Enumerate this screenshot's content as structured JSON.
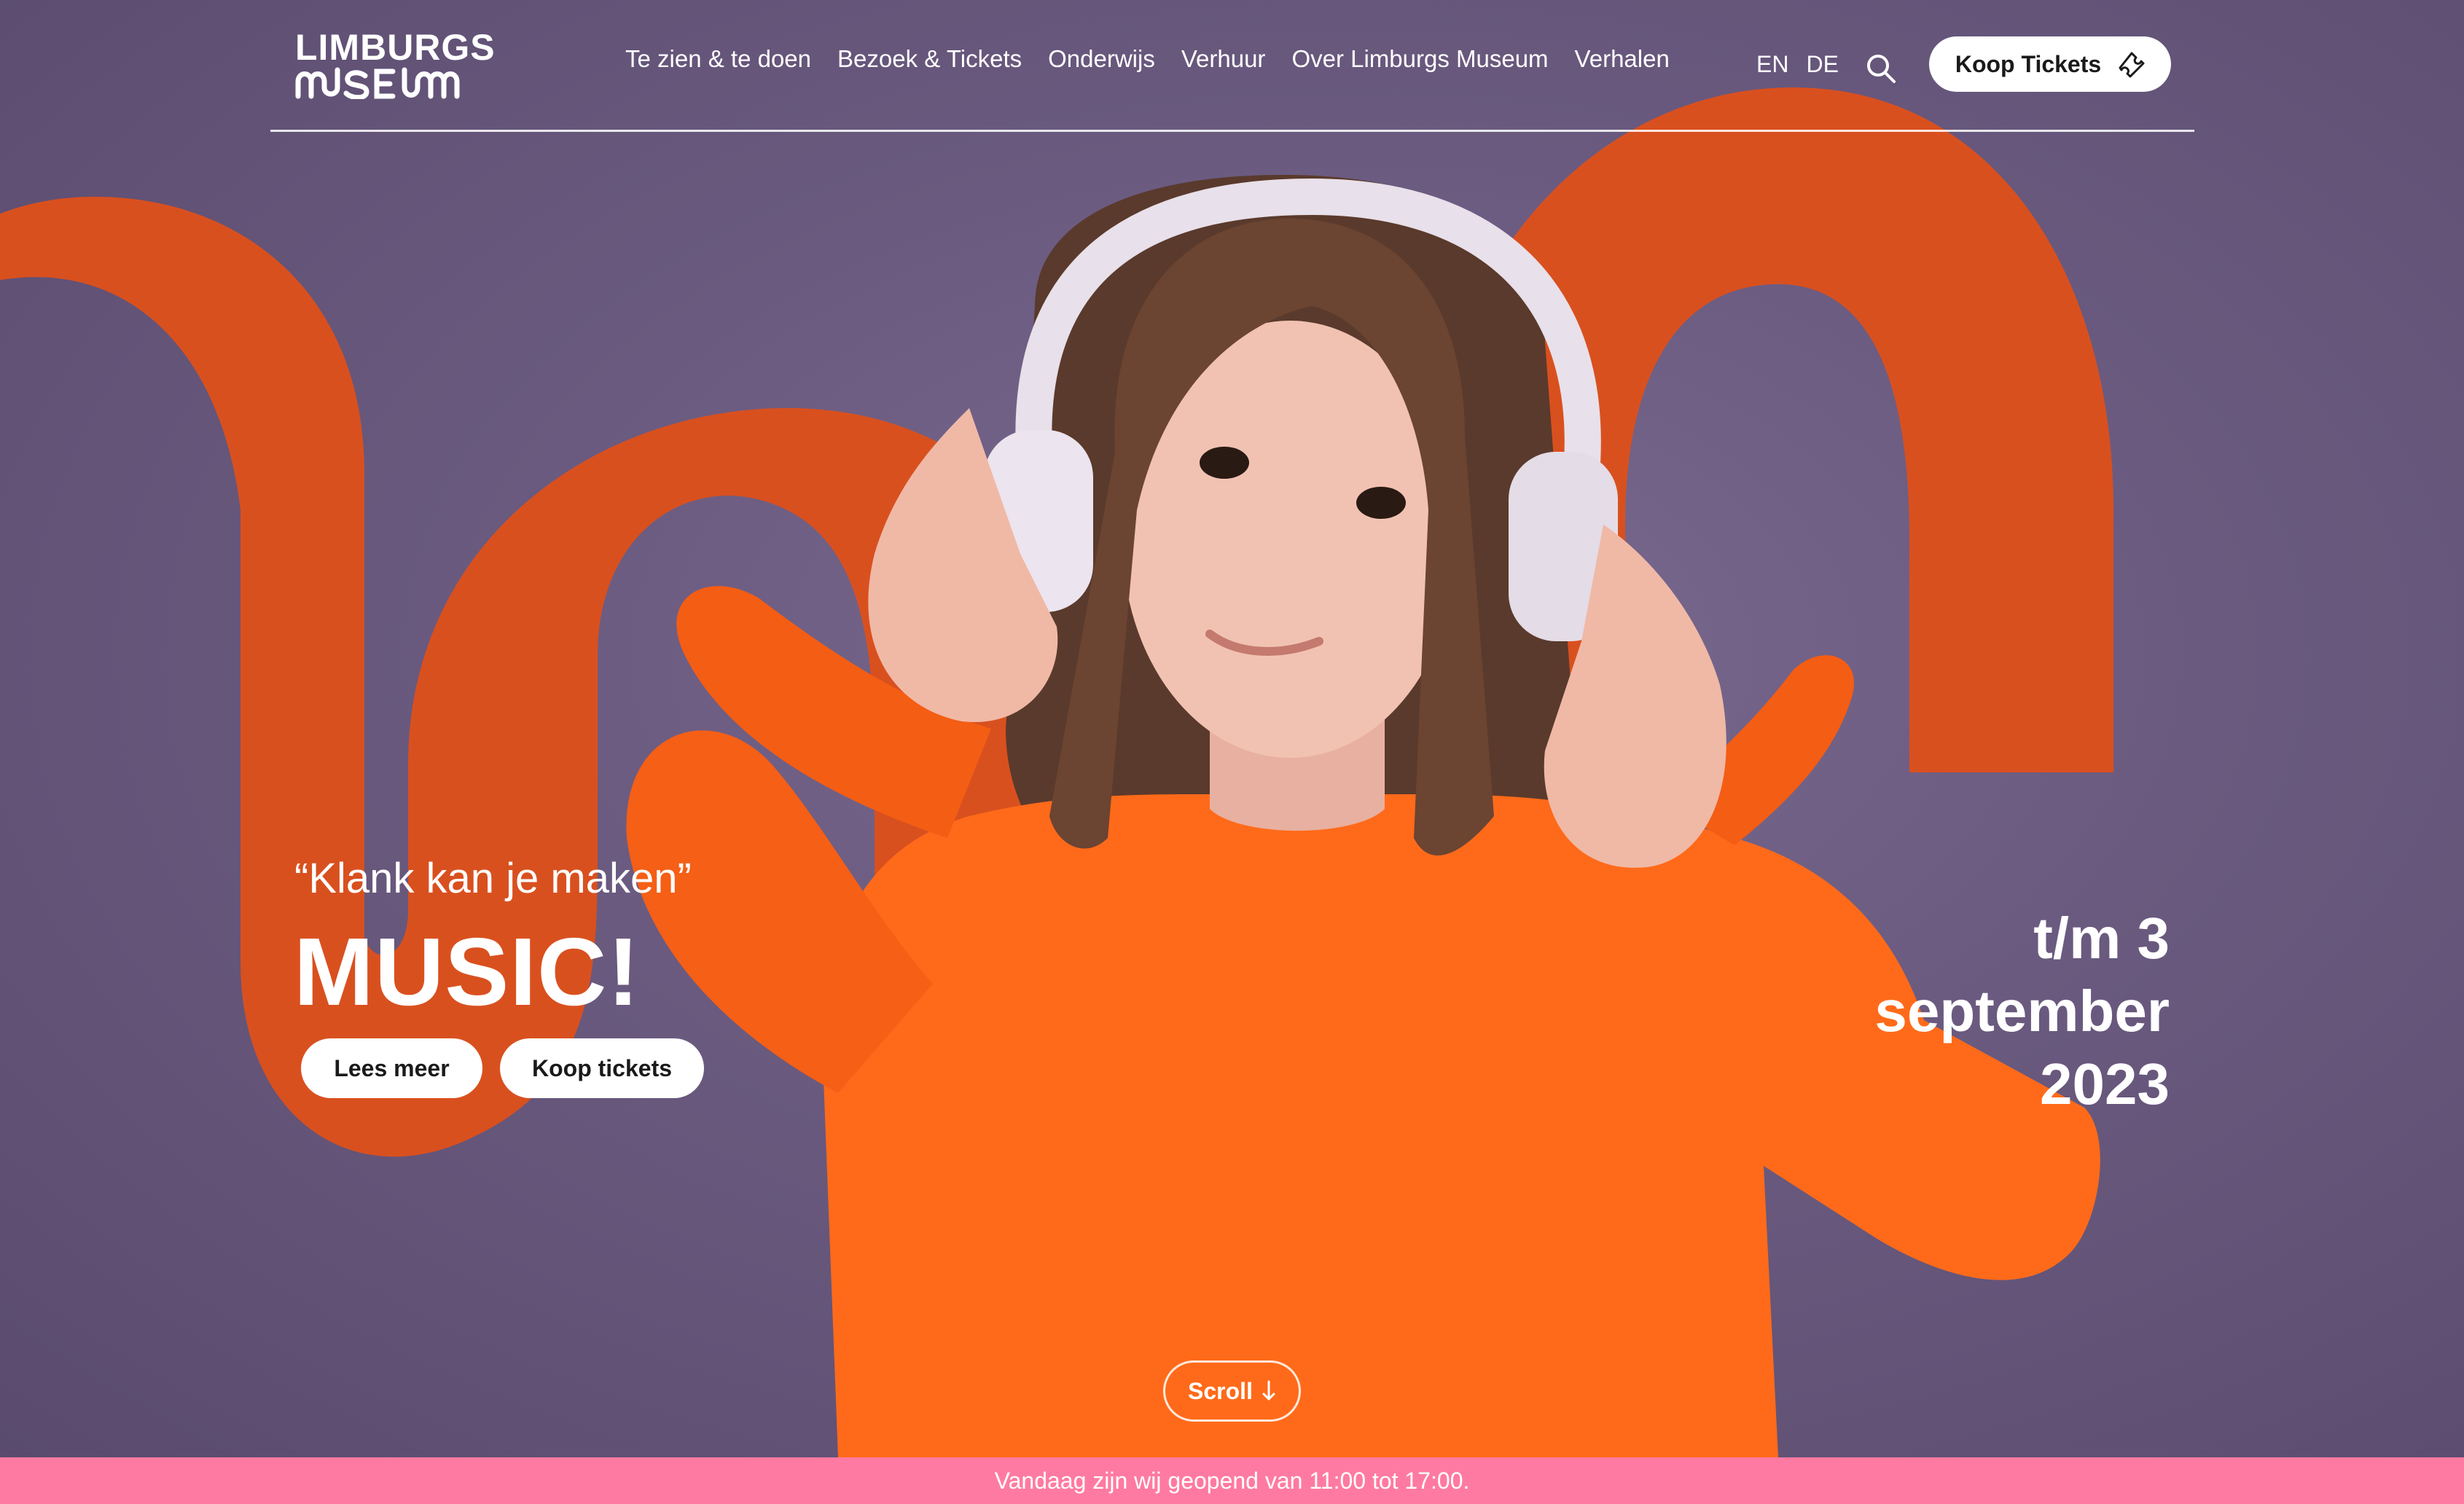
{
  "logo": {
    "line1": "LIMBURGS",
    "line2": "MUSEUM"
  },
  "nav": {
    "items": [
      {
        "label": "Te zien & te doen"
      },
      {
        "label": "Bezoek & Tickets"
      },
      {
        "label": "Onderwijs"
      },
      {
        "label": "Verhuur"
      },
      {
        "label": "Over Limburgs Museum"
      },
      {
        "label": "Verhalen"
      }
    ]
  },
  "languages": {
    "en": "EN",
    "de": "DE"
  },
  "header": {
    "cta_label": "Koop Tickets",
    "search_icon": "search-icon",
    "ticket_icon": "ticket-icon"
  },
  "hero": {
    "quote": "“Klank kan je maken”",
    "title": "MUSIC!",
    "button_more": "Lees meer",
    "button_tickets": "Koop tickets",
    "date_line1": "t/m 3",
    "date_line2": "september",
    "date_line3": "2023",
    "scroll_label": "Scroll",
    "scroll_icon": "arrow-down-icon"
  },
  "notice": {
    "text": "Vandaag zijn wij geopend van 11:00 tot 17:00."
  },
  "colors": {
    "background": "#6b5a80",
    "accent_orange": "#d9501f",
    "sweater": "#ff6a1a",
    "notice_pink": "#ff7aa2"
  }
}
